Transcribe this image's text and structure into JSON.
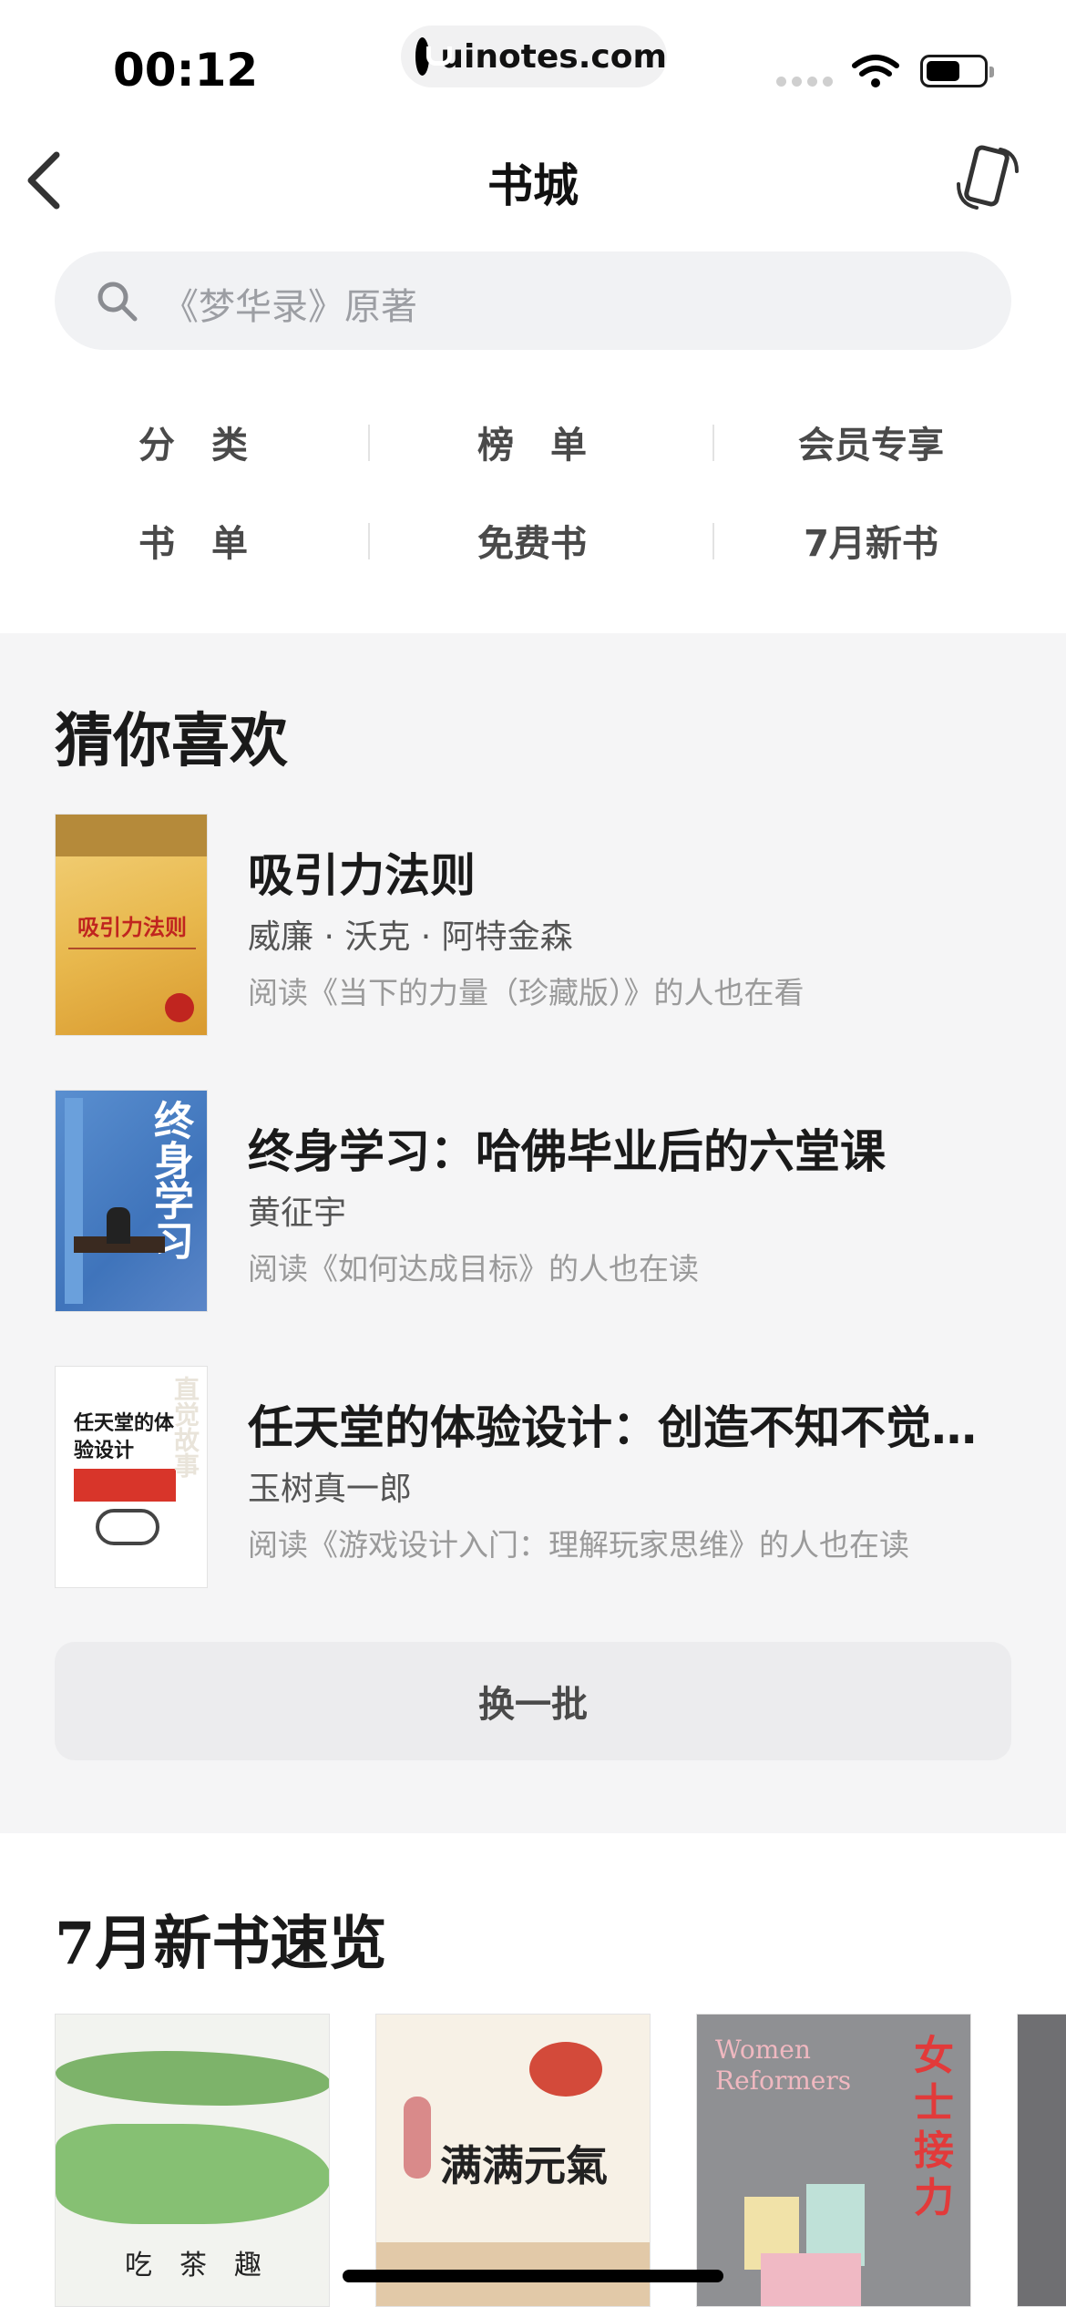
{
  "status_bar": {
    "time": "00:12",
    "url": "uinotes.com"
  },
  "nav": {
    "title": "书城"
  },
  "search": {
    "placeholder": "《梦华录》原著"
  },
  "categories": [
    {
      "label": "分　类"
    },
    {
      "label": "榜　单"
    },
    {
      "label": "会员专享"
    },
    {
      "label": "书　单"
    },
    {
      "label": "免费书"
    },
    {
      "label": "7月新书"
    }
  ],
  "guess_section": {
    "title": "猜你喜欢",
    "books": [
      {
        "title": "吸引力法则",
        "author": "威廉 · 沃克 · 阿特金森",
        "reason": "阅读《当下的力量（珍藏版）》的人也在看",
        "cover_text": "吸引力法则"
      },
      {
        "title": "终身学习：哈佛毕业后的六堂课",
        "author": "黄征宇",
        "reason": "阅读《如何达成目标》的人也在读",
        "cover_text": "终身学习"
      },
      {
        "title": "任天堂的体验设计：创造不知不觉打…",
        "author": "玉树真一郎",
        "reason": "阅读《游戏设计入门：理解玩家思维》的人也在读",
        "cover_text": "任天堂的体验设计"
      }
    ],
    "refresh_label": "换一批"
  },
  "new_books_section": {
    "title": "7月新书速览",
    "covers": [
      {
        "text": "吃　茶　趣"
      },
      {
        "text": "满满元氣"
      },
      {
        "text": "Women Reformers"
      },
      {
        "text": "女士接力"
      }
    ]
  },
  "colors": {
    "background": "#f5f5f6",
    "card": "#ffffff",
    "refresh_button": "#ececee"
  }
}
